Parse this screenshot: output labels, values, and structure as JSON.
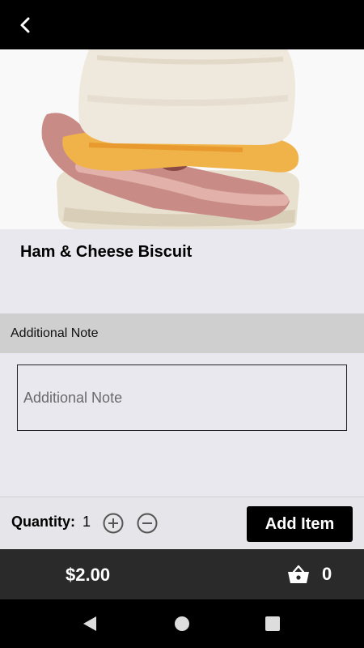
{
  "header": {
    "back_icon": "chevron-left-icon"
  },
  "item": {
    "title": "Ham & Cheese Biscuit"
  },
  "note": {
    "section_label": "Additional Note",
    "placeholder": "Additional Note",
    "value": ""
  },
  "quantity": {
    "label": "Quantity:",
    "value": "1",
    "increase_icon": "plus-circle-icon",
    "decrease_icon": "minus-circle-icon"
  },
  "actions": {
    "add_label": "Add Item"
  },
  "footer": {
    "price": "$2.00",
    "cart_icon": "basket-icon",
    "cart_count": "0"
  },
  "colors": {
    "topbar": "#000000",
    "price_bar": "#2a2a2a",
    "accent": "#000000",
    "background": "#e8e8ee",
    "note_header": "#cfcfcf"
  },
  "system_nav": {
    "back_icon": "triangle-back-icon",
    "home_icon": "circle-home-icon",
    "recent_icon": "square-recents-icon"
  }
}
